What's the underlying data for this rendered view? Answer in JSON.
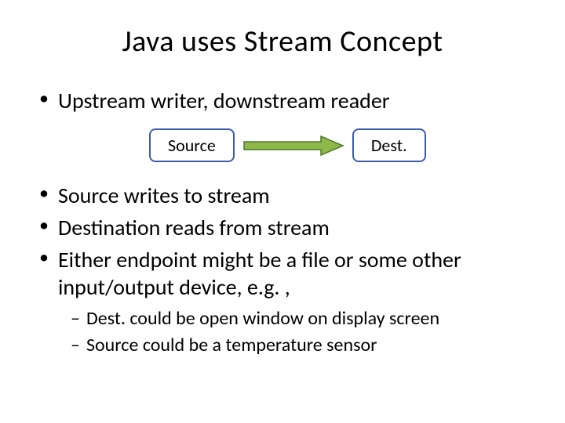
{
  "title": "Java uses Stream Concept",
  "bullets": {
    "b1": "Upstream writer, downstream reader",
    "b2": "Source writes to stream",
    "b3": "Destination reads from stream",
    "b4": "Either endpoint might be a file or some other input/output device, e.g. ,"
  },
  "sub_bullets": {
    "s1": "Dest. could be open window on display screen",
    "s2": "Source could be a temperature sensor"
  },
  "diagram": {
    "source_label": "Source",
    "dest_label": "Dest.",
    "arrow_color_fill": "#8fb84a",
    "arrow_color_stroke": "#4a7a2a",
    "box_border": "#3a5da8"
  }
}
